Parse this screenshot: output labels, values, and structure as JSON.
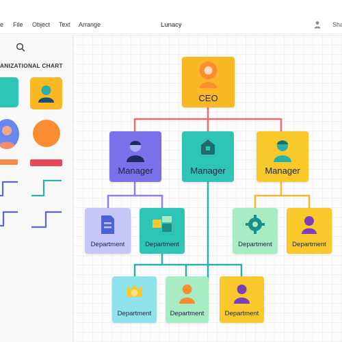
{
  "menubar": {
    "items": [
      "e",
      "File",
      "Object",
      "Text",
      "Arrange"
    ],
    "app_title": "Lunacy",
    "share_label": "Sha"
  },
  "sidebar": {
    "heading": "ANIZATIONAL CHART"
  },
  "chart": {
    "ceo": {
      "label": "CEO",
      "icon": "person-icon",
      "color": "#f9b824"
    },
    "managers": [
      {
        "label": "Manager",
        "icon": "person-icon",
        "color": "#7b6fea"
      },
      {
        "label": "Manager",
        "icon": "home-icon",
        "color": "#2ec4b6"
      },
      {
        "label": "Manager",
        "icon": "person-icon",
        "color": "#f9c92b"
      }
    ],
    "departments": [
      {
        "label": "Department",
        "icon": "document-icon",
        "color": "#c6c6f9"
      },
      {
        "label": "Department",
        "icon": "layout-icon",
        "color": "#2ec4b6"
      },
      {
        "label": "Department",
        "icon": "gear-icon",
        "color": "#a8ecc4"
      },
      {
        "label": "Department",
        "icon": "person-icon",
        "color": "#f9c92b"
      },
      {
        "label": "Department",
        "icon": "crown-icon",
        "color": "#8fe1ea"
      },
      {
        "label": "Department",
        "icon": "person-icon",
        "color": "#a8ecc4"
      },
      {
        "label": "Department",
        "icon": "person-icon",
        "color": "#f9c92b"
      }
    ]
  },
  "colors": {
    "connector_red": "#e96d6d",
    "connector_teal": "#2ab0a8",
    "connector_purple": "#8b7ff0",
    "connector_yellow": "#f5b92a"
  }
}
